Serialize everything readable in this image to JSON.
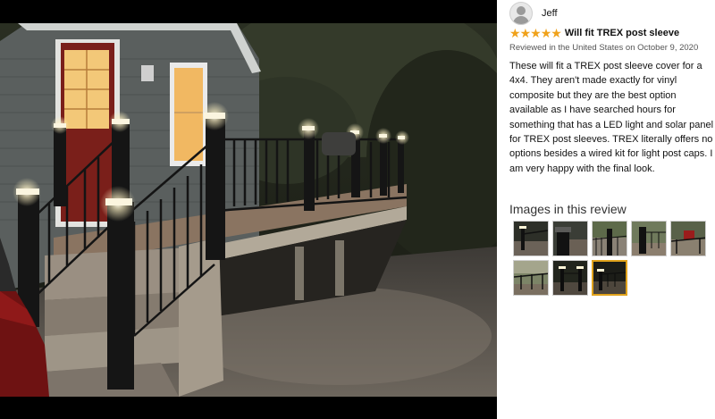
{
  "photo": {
    "alt": "Deck with lit post caps at night"
  },
  "review": {
    "reviewer_name": "Jeff",
    "rating": 5,
    "stars": [
      "★",
      "★",
      "★",
      "★",
      "★"
    ],
    "title": "Will fit TREX post sleeve",
    "date": "Reviewed in the United States on October 9, 2020",
    "body": "These will fit a TREX post sleeve cover for a 4x4. They aren't made exactly for vinyl composite but they are the best option available as I have searched hours for something that has a LED light and solar panel for TREX post sleeves. TREX literally offers no options besides a wired kit for light post caps. I am very happy with the final look.",
    "images_heading": "Images in this review",
    "thumbnails": [
      {
        "id": "t1",
        "selected": false
      },
      {
        "id": "t2",
        "selected": false
      },
      {
        "id": "t3",
        "selected": false
      },
      {
        "id": "t4",
        "selected": false
      },
      {
        "id": "t5",
        "selected": false
      },
      {
        "id": "t6",
        "selected": false
      },
      {
        "id": "t7",
        "selected": false
      },
      {
        "id": "t8",
        "selected": true
      }
    ]
  },
  "colors": {
    "star": "#f0a21b",
    "selected_border": "#e0a21c",
    "panel_bg": "#ffffff"
  }
}
